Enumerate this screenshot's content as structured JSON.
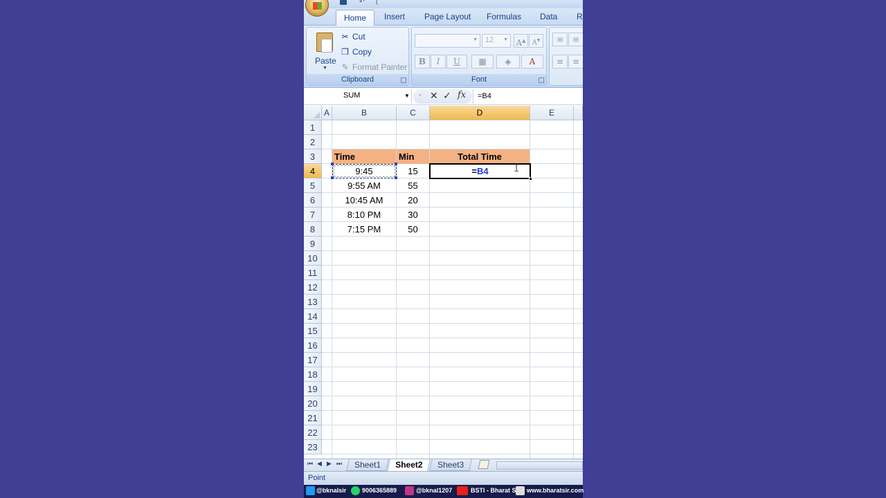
{
  "ribbon": {
    "tabs": [
      {
        "label": "Home",
        "active": true
      },
      {
        "label": "Insert"
      },
      {
        "label": "Page Layout"
      },
      {
        "label": "Formulas"
      },
      {
        "label": "Data"
      },
      {
        "label": "Re"
      }
    ],
    "clipboard": {
      "paste_label": "Paste",
      "cut_label": "Cut",
      "copy_label": "Copy",
      "format_painter_label": "Format Painter",
      "group_label": "Clipboard"
    },
    "font": {
      "font_name": "",
      "font_size": "12",
      "bold": "B",
      "italic": "I",
      "underline": "U",
      "group_label": "Font"
    }
  },
  "formula_bar": {
    "name_box": "SUM",
    "formula": "=B4"
  },
  "sheet": {
    "columns": [
      "A",
      "B",
      "C",
      "D",
      "E"
    ],
    "selected_column": "D",
    "rows": [
      "1",
      "2",
      "3",
      "4",
      "5",
      "6",
      "7",
      "8",
      "9",
      "10",
      "11",
      "12",
      "13",
      "14",
      "15",
      "16",
      "17",
      "18",
      "19",
      "20",
      "21",
      "22",
      "23"
    ],
    "selected_row": "4",
    "headers": {
      "time": "Time",
      "min": "Min",
      "total": "Total Time"
    },
    "data": [
      {
        "time": "9:45",
        "min": "15"
      },
      {
        "time": "9:55 AM",
        "min": "55"
      },
      {
        "time": "10:45 AM",
        "min": "20"
      },
      {
        "time": "8:10 PM",
        "min": "30"
      },
      {
        "time": "7:15 PM",
        "min": "50"
      }
    ],
    "active_cell": {
      "prefix": "=",
      "ref": "B4"
    }
  },
  "sheet_tabs": [
    {
      "label": "Sheet1"
    },
    {
      "label": "Sheet2",
      "active": true
    },
    {
      "label": "Sheet3"
    }
  ],
  "status": {
    "mode": "Point"
  },
  "footer": {
    "twitter": "@bknalsir",
    "whatsapp": "9006365889",
    "instagram": "@bknal1207",
    "youtube": "BSTI - Bharat Sir",
    "website": "www.bharatsir.com"
  },
  "colors": {
    "background": "#3f3f95",
    "header_fill": "#f4b183",
    "selected_header": "#f1b94c",
    "ribbon_text": "#15428b",
    "reference_blue": "#1c3fd1"
  }
}
